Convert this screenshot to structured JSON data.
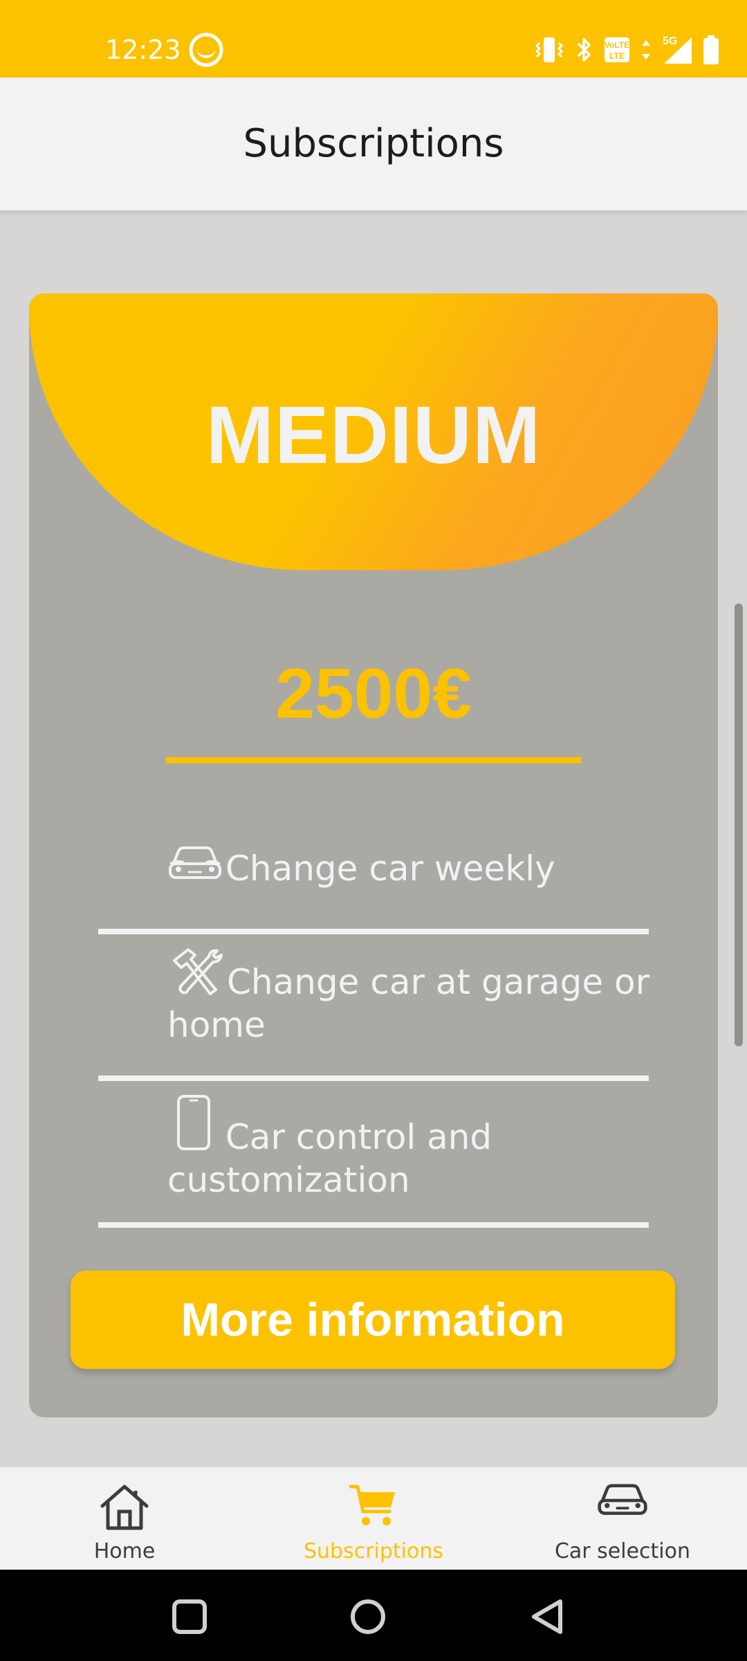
{
  "status_bar": {
    "time": "12:23",
    "background": "#fcc200",
    "icons": [
      "face-icon",
      "vibrate-icon",
      "bluetooth-icon",
      "volte-icon",
      "data-arrows-icon",
      "signal-5g-icon",
      "battery-icon"
    ],
    "network_label": "5G",
    "volte_label": "VoLTE"
  },
  "header": {
    "title": "Subscriptions"
  },
  "plan_card": {
    "name": "MEDIUM",
    "price": "2500€",
    "accent_color": "#fcc200",
    "features": [
      {
        "icon": "car-icon",
        "text": "Change car weekly"
      },
      {
        "icon": "tools-icon",
        "text": "Change car at garage or home"
      },
      {
        "icon": "phone-icon",
        "text": " Car control and customization"
      }
    ],
    "button_label": "More information"
  },
  "bottom_nav": {
    "items": [
      {
        "label": "Home",
        "icon": "home-icon",
        "active": false
      },
      {
        "label": "Subscriptions",
        "icon": "cart-icon",
        "active": true
      },
      {
        "label": "Car selection",
        "icon": "car-icon",
        "active": false
      }
    ]
  },
  "system_nav": {
    "buttons": [
      "recents-square-icon",
      "home-circle-icon",
      "back-triangle-icon"
    ]
  }
}
